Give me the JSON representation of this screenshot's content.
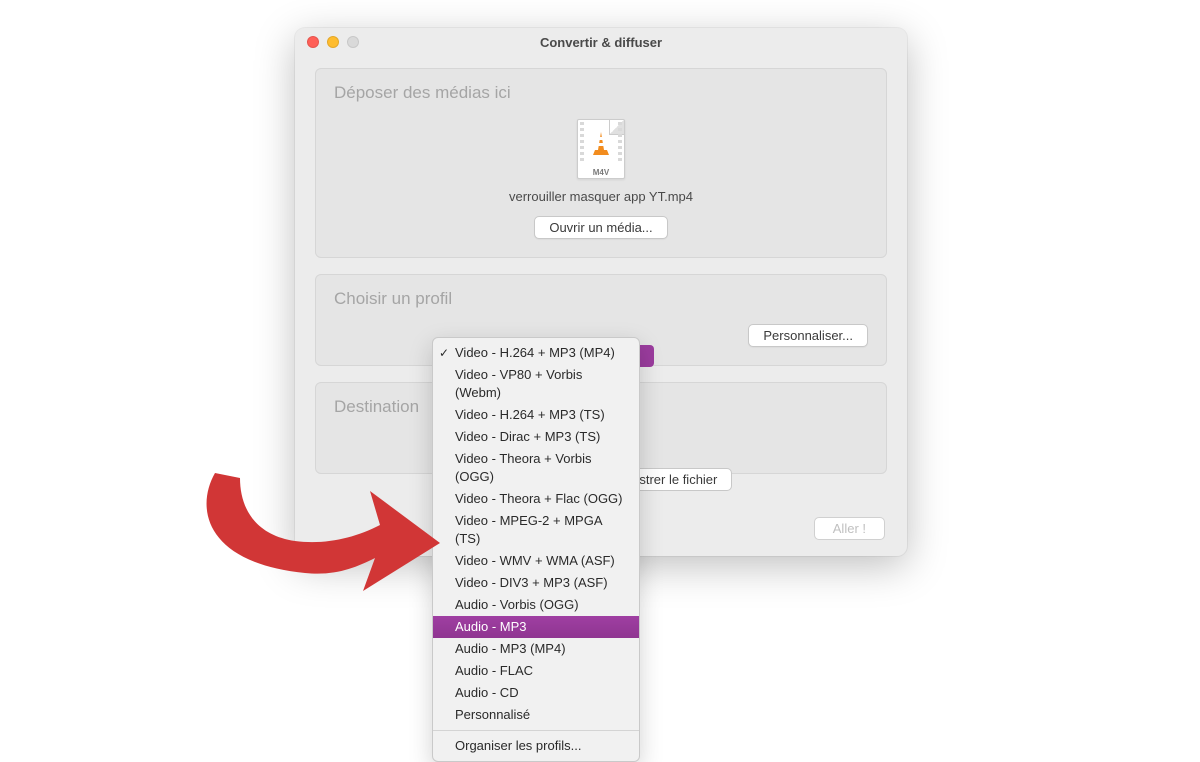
{
  "window": {
    "title": "Convertir & diffuser"
  },
  "dropzone": {
    "title": "Déposer des médias ici",
    "file_extension": "M4V",
    "filename": "verrouiller masquer app YT.mp4",
    "open_button": "Ouvrir un média..."
  },
  "profile": {
    "title": "Choisir un profil",
    "customize_button": "Personnaliser..."
  },
  "destination": {
    "title": "Destination",
    "save_button_partial": "egistrer le fichier"
  },
  "go_button": "Aller !",
  "dropdown": {
    "items": [
      {
        "label": "Video - H.264 + MP3 (MP4)",
        "checked": true,
        "highlighted": false
      },
      {
        "label": "Video - VP80 + Vorbis (Webm)",
        "checked": false,
        "highlighted": false
      },
      {
        "label": "Video - H.264 + MP3 (TS)",
        "checked": false,
        "highlighted": false
      },
      {
        "label": "Video - Dirac + MP3 (TS)",
        "checked": false,
        "highlighted": false
      },
      {
        "label": "Video - Theora + Vorbis (OGG)",
        "checked": false,
        "highlighted": false
      },
      {
        "label": "Video - Theora + Flac (OGG)",
        "checked": false,
        "highlighted": false
      },
      {
        "label": "Video - MPEG-2 + MPGA (TS)",
        "checked": false,
        "highlighted": false
      },
      {
        "label": "Video - WMV + WMA (ASF)",
        "checked": false,
        "highlighted": false
      },
      {
        "label": "Video - DIV3 + MP3 (ASF)",
        "checked": false,
        "highlighted": false
      },
      {
        "label": "Audio - Vorbis (OGG)",
        "checked": false,
        "highlighted": false
      },
      {
        "label": "Audio - MP3",
        "checked": false,
        "highlighted": true
      },
      {
        "label": "Audio - MP3 (MP4)",
        "checked": false,
        "highlighted": false
      },
      {
        "label": "Audio - FLAC",
        "checked": false,
        "highlighted": false
      },
      {
        "label": "Audio - CD",
        "checked": false,
        "highlighted": false
      },
      {
        "label": "Personnalisé",
        "checked": false,
        "highlighted": false
      }
    ],
    "footer": "Organiser les profils..."
  },
  "annotation": {
    "arrow_color": "#d13636"
  }
}
